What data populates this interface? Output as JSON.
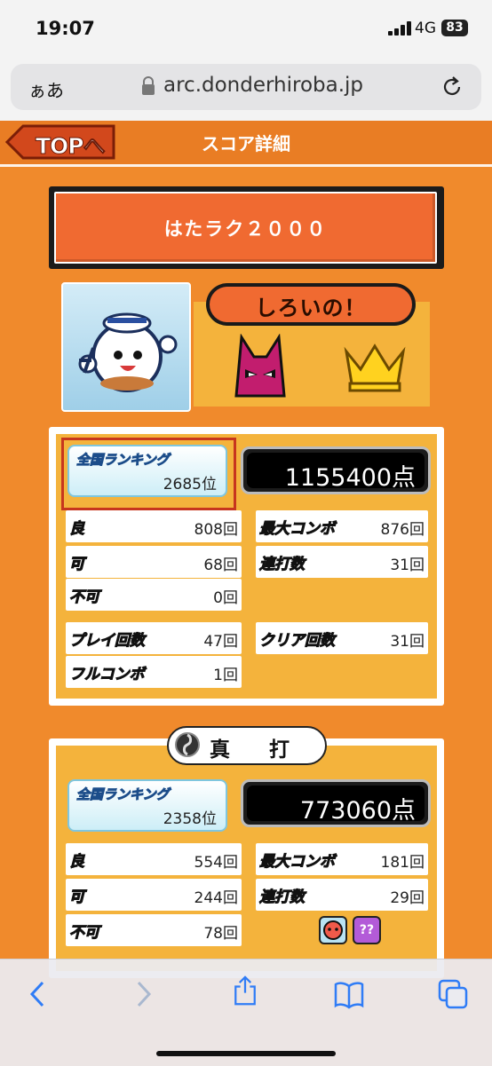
{
  "status_bar": {
    "time": "19:07",
    "network": "4G",
    "battery": "83"
  },
  "browser": {
    "aa_label": "ぁあ",
    "url": "arc.donderhiroba.jp"
  },
  "header": {
    "top_button": "TOPへ",
    "title": "スコア詳細"
  },
  "song": {
    "title": "はたラク２０００"
  },
  "profile": {
    "nickname": "しろいの！"
  },
  "oni": {
    "rank_label": "全国ランキング",
    "rank_value": "2685位",
    "score": "1155400点",
    "stats": [
      {
        "label": "良",
        "value": "808回"
      },
      {
        "label": "最大コンボ",
        "value": "876回"
      },
      {
        "label": "可",
        "value": "68回"
      },
      {
        "label": "連打数",
        "value": "31回"
      },
      {
        "label": "不可",
        "value": "0回"
      },
      {
        "label": "プレイ回数",
        "value": "47回"
      },
      {
        "label": "クリア回数",
        "value": "31回"
      },
      {
        "label": "フルコンボ",
        "value": "1回"
      }
    ]
  },
  "ura": {
    "difficulty": "真 打",
    "rank_label": "全国ランキング",
    "rank_value": "2358位",
    "score": "773060点",
    "stats": [
      {
        "label": "良",
        "value": "554回"
      },
      {
        "label": "最大コンボ",
        "value": "181回"
      },
      {
        "label": "可",
        "value": "244回"
      },
      {
        "label": "連打数",
        "value": "29回"
      },
      {
        "label": "不可",
        "value": "78回"
      }
    ],
    "icon_unknown": "??"
  },
  "toolbar": {
    "icons": [
      "back-icon",
      "forward-icon",
      "share-icon",
      "bookmarks-icon",
      "tabs-icon"
    ]
  }
}
